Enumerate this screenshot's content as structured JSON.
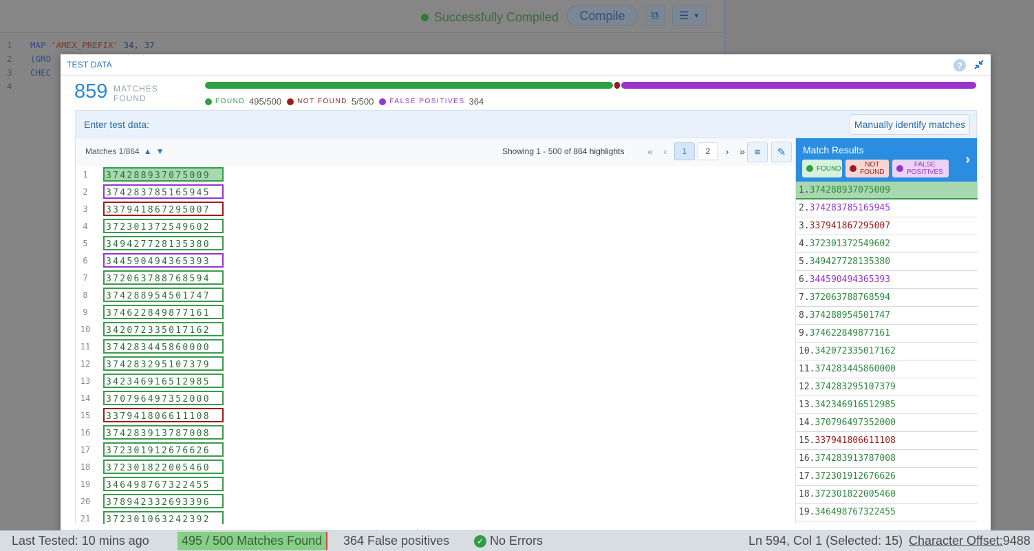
{
  "background": {
    "status": "Successfully Compiled",
    "compile_label": "Compile",
    "code": [
      {
        "num": "1",
        "kw": "MAP",
        "str": " 'AMEX_PREFIX'",
        "rest": " 34, 37"
      },
      {
        "num": "2",
        "kw": "(GRO",
        "str": "",
        "rest": ""
      },
      {
        "num": "3",
        "kw": "CHEC",
        "str": "",
        "rest": ""
      },
      {
        "num": "4",
        "kw": "",
        "str": "",
        "rest": ""
      }
    ]
  },
  "modal": {
    "title": "TEST DATA",
    "help_icon": "help-icon",
    "collapse_icon": "collapse-icon",
    "summary": {
      "count": "859",
      "count_label_1": "MATCHES",
      "count_label_2": "FOUND",
      "progress": {
        "found_fraction": 0.532,
        "notfound_fraction": 0.006,
        "falsepos_fraction": 0.462
      },
      "legend": [
        {
          "name": "FOUND",
          "value": "495/500",
          "color": "#2ea043"
        },
        {
          "name": "NOT FOUND",
          "value": "5/500",
          "color": "#9c1b1b"
        },
        {
          "name": "FALSE POSITIVES",
          "value": "364",
          "color": "#9933cc"
        }
      ]
    },
    "entry_label": "Enter test data:",
    "manual_button": "Manually identify matches",
    "toolbar": {
      "matches_label": "Matches 1/864",
      "showing": "Showing 1 - 500 of 864 highlights",
      "pages": [
        "1",
        "2"
      ]
    },
    "lines": [
      {
        "num": "1",
        "value": "374288937075009",
        "status": "found",
        "hl": true
      },
      {
        "num": "2",
        "value": "374283785165945",
        "status": "falsepos"
      },
      {
        "num": "3",
        "value": "337941867295007",
        "status": "notfound"
      },
      {
        "num": "4",
        "value": "372301372549602",
        "status": "found"
      },
      {
        "num": "5",
        "value": "349427728135380",
        "status": "found"
      },
      {
        "num": "6",
        "value": "344590494365393",
        "status": "falsepos"
      },
      {
        "num": "7",
        "value": "372063788768594",
        "status": "found"
      },
      {
        "num": "8",
        "value": "374288954501747",
        "status": "found"
      },
      {
        "num": "9",
        "value": "374622849877161",
        "status": "found"
      },
      {
        "num": "10",
        "value": "342072335017162",
        "status": "found"
      },
      {
        "num": "11",
        "value": "374283445860000",
        "status": "found"
      },
      {
        "num": "12",
        "value": "374283295107379",
        "status": "found"
      },
      {
        "num": "13",
        "value": "342346916512985",
        "status": "found"
      },
      {
        "num": "14",
        "value": "370796497352000",
        "status": "found"
      },
      {
        "num": "15",
        "value": "337941806611108",
        "status": "notfound"
      },
      {
        "num": "16",
        "value": "374283913787008",
        "status": "found"
      },
      {
        "num": "17",
        "value": "372301912676626",
        "status": "found"
      },
      {
        "num": "18",
        "value": "372301822005460",
        "status": "found"
      },
      {
        "num": "19",
        "value": "346498767322455",
        "status": "found"
      },
      {
        "num": "20",
        "value": "378942332693396",
        "status": "found"
      },
      {
        "num": "21",
        "value": "372301063242392",
        "status": "found"
      }
    ],
    "results": {
      "title": "Match Results",
      "chips": [
        {
          "label": "FOUND",
          "kind": "found"
        },
        {
          "label": "NOT FOUND",
          "kind": "notfound"
        },
        {
          "label": "FALSE POSITIVES",
          "kind": "falsepos"
        }
      ],
      "rows": [
        {
          "num": "1.",
          "value": "374288937075009",
          "status": "found",
          "selected": true
        },
        {
          "num": "2.",
          "value": "374283785165945",
          "status": "falsepos"
        },
        {
          "num": "3.",
          "value": "337941867295007",
          "status": "notfound"
        },
        {
          "num": "4.",
          "value": "372301372549602",
          "status": "found"
        },
        {
          "num": "5.",
          "value": "349427728135380",
          "status": "found"
        },
        {
          "num": "6.",
          "value": "344590494365393",
          "status": "falsepos"
        },
        {
          "num": "7.",
          "value": "372063788768594",
          "status": "found"
        },
        {
          "num": "8.",
          "value": "374288954501747",
          "status": "found"
        },
        {
          "num": "9.",
          "value": "374622849877161",
          "status": "found"
        },
        {
          "num": "10.",
          "value": "342072335017162",
          "status": "found"
        },
        {
          "num": "11.",
          "value": "374283445860000",
          "status": "found"
        },
        {
          "num": "12.",
          "value": "374283295107379",
          "status": "found"
        },
        {
          "num": "13.",
          "value": "342346916512985",
          "status": "found"
        },
        {
          "num": "14.",
          "value": "370796497352000",
          "status": "found"
        },
        {
          "num": "15.",
          "value": "337941806611108",
          "status": "notfound"
        },
        {
          "num": "16.",
          "value": "374283913787008",
          "status": "found"
        },
        {
          "num": "17.",
          "value": "372301912676626",
          "status": "found"
        },
        {
          "num": "18.",
          "value": "372301822005460",
          "status": "found"
        },
        {
          "num": "19.",
          "value": "346498767322455",
          "status": "found"
        }
      ]
    }
  },
  "statusbar": {
    "last_tested": "Last Tested: 10 mins ago",
    "matches": "495 / 500 Matches Found",
    "false_positives": "364 False positives",
    "errors": "No Errors",
    "position": "Ln 594, Col 1 (Selected: 15)",
    "offset_label": "Character Offset:",
    "offset_value": "9488"
  }
}
